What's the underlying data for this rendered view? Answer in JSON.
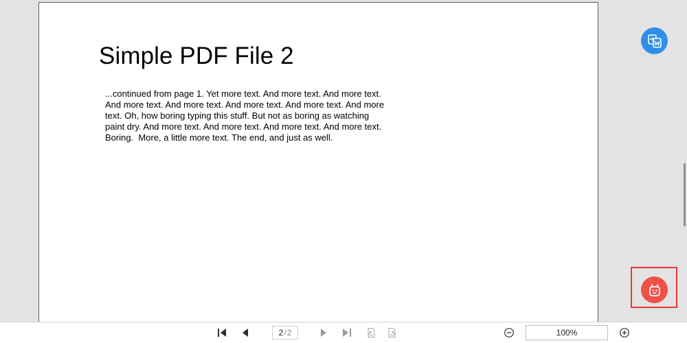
{
  "document": {
    "title": "Simple PDF File 2",
    "body": "...continued from page 1. Yet more text. And more text. And more text.\nAnd more text. And more text. And more text. And more text. And more\ntext. Oh, how boring typing this stuff. But not as boring as watching\npaint dry. And more text. And more text. And more text. And more text.\nBoring.  More, a little more text. The end, and just as well."
  },
  "side_buttons": {
    "convert": {
      "icon": "convert-to-word-icon",
      "color": "#2f8fe8"
    },
    "assistant": {
      "icon": "robot-assistant-icon",
      "color": "#ef5148",
      "highlight_color": "#e23a36"
    }
  },
  "toolbar": {
    "first_page_icon": "first-page-icon",
    "prev_page_icon": "previous-page-icon",
    "current_page": "2",
    "page_separator": "/",
    "total_pages": "2",
    "next_page_icon": "next-page-icon",
    "last_page_icon": "last-page-icon",
    "rotate_ccw_icon": "rotate-counterclockwise-icon",
    "rotate_cw_icon": "rotate-clockwise-icon",
    "zoom_out_icon": "zoom-out-icon",
    "zoom_value": "100%",
    "zoom_in_icon": "zoom-in-icon"
  }
}
